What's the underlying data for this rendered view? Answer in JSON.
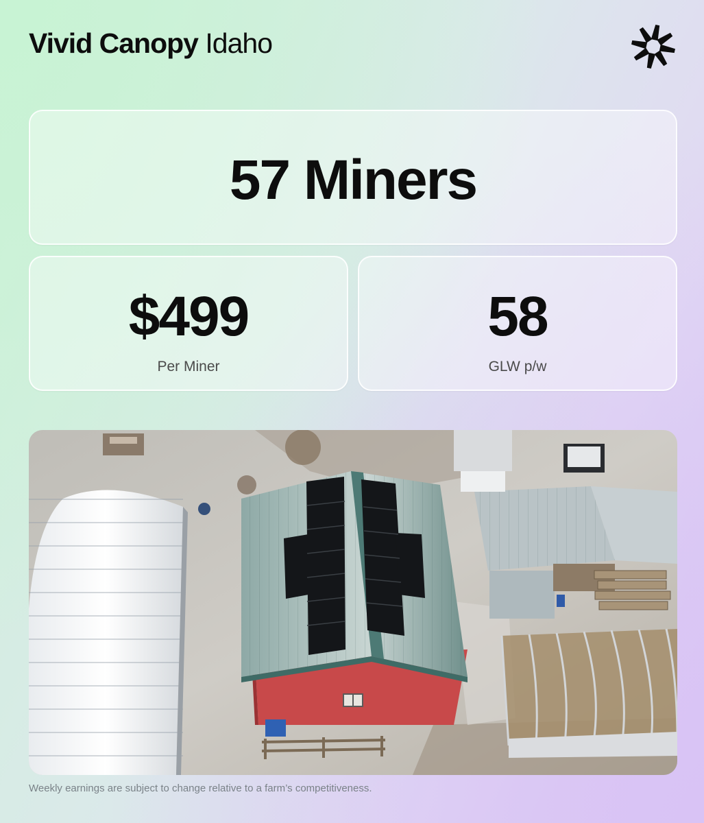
{
  "header": {
    "brand_bold": "Vivid Canopy",
    "brand_regular": "Idaho",
    "logo_icon": "starburst-logo-icon"
  },
  "hero": {
    "miners": "57 Miners"
  },
  "stats": [
    {
      "value": "$499",
      "label": "Per Miner"
    },
    {
      "value": "58",
      "label": "GLW p/w"
    }
  ],
  "photo": {
    "subject_icon": "farm-photo"
  },
  "footer": {
    "disclaimer": "Weekly earnings are subject to change relative to a farm’s competitiveness."
  },
  "colors": {
    "text": "#0d0d0d",
    "label": "#4a4a4a",
    "disclaimer": "#7a8288",
    "gradient_left": "#cdf2d8",
    "gradient_right": "#d8c6f4"
  }
}
